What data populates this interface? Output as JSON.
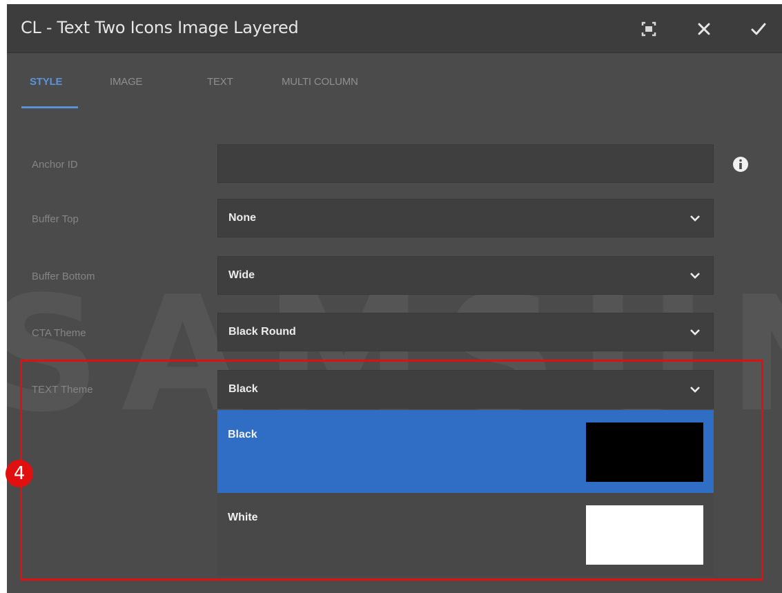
{
  "dialog": {
    "title": "CL - Text Two Icons Image Layered",
    "actions": [
      {
        "name": "fullscreen-icon"
      },
      {
        "name": "close-icon"
      },
      {
        "name": "check-icon"
      }
    ]
  },
  "tabs": [
    {
      "label": "STYLE",
      "active": true
    },
    {
      "label": "IMAGE",
      "active": false
    },
    {
      "label": "TEXT",
      "active": false
    },
    {
      "label": "MULTI COLUMN",
      "active": false
    }
  ],
  "form": {
    "anchor_id": {
      "label": "Anchor ID",
      "value": "",
      "info_icon": "info-icon"
    },
    "buffer_top": {
      "label": "Buffer Top",
      "value": "None"
    },
    "buffer_bottom": {
      "label": "Buffer Bottom",
      "value": "Wide"
    },
    "cta_theme": {
      "label": "CTA Theme",
      "value": "Black Round"
    },
    "text_theme": {
      "label": "TEXT Theme",
      "value": "Black",
      "options": [
        {
          "label": "Black",
          "swatch_color": "#000000",
          "selected": true
        },
        {
          "label": "White",
          "swatch_color": "#ffffff",
          "selected": false
        }
      ]
    }
  },
  "watermark": "SAMSUNG",
  "annotation": {
    "step_number": "4",
    "color": "#e01010"
  },
  "colors": {
    "accent": "#5b93d9",
    "selected_option": "#2f6ec4",
    "panel": "#4b4b4b"
  }
}
